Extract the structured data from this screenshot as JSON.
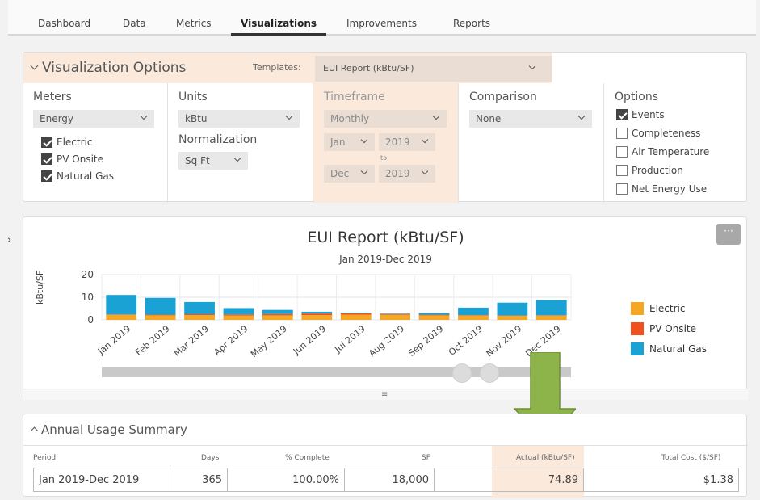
{
  "nav": {
    "tabs": [
      "Dashboard",
      "Data",
      "Metrics",
      "Visualizations",
      "Improvements",
      "Reports"
    ],
    "active": "Visualizations"
  },
  "options": {
    "title": "Visualization Options",
    "templates_label": "Templates:",
    "template_value": "EUI Report (kBtu/SF)",
    "meters": {
      "title": "Meters",
      "value": "Energy",
      "items": [
        {
          "label": "Electric",
          "checked": true
        },
        {
          "label": "PV Onsite",
          "checked": true
        },
        {
          "label": "Natural Gas",
          "checked": true
        }
      ]
    },
    "units": {
      "title": "Units",
      "value": "kBtu",
      "normalization_title": "Normalization",
      "normalization_value": "Sq Ft"
    },
    "timeframe": {
      "title": "Timeframe",
      "period": "Monthly",
      "start_month": "Jan",
      "start_year": "2019",
      "to": "to",
      "end_month": "Dec",
      "end_year": "2019"
    },
    "comparison": {
      "title": "Comparison",
      "value": "None"
    },
    "extras": {
      "title": "Options",
      "items": [
        {
          "label": "Events",
          "checked": true
        },
        {
          "label": "Completeness",
          "checked": false
        },
        {
          "label": "Air Temperature",
          "checked": false
        },
        {
          "label": "Production",
          "checked": false
        },
        {
          "label": "Net Energy Use",
          "checked": false
        }
      ]
    }
  },
  "chart_panel": {
    "more_label": "···",
    "grip": "≡"
  },
  "chart_data": {
    "type": "bar",
    "title": "EUI Report (kBtu/SF)",
    "subtitle": "Jan 2019-Dec 2019",
    "ylabel": "kBtu/SF",
    "xlabel": "",
    "ylim": [
      0,
      20
    ],
    "yticks": [
      0,
      10,
      20
    ],
    "stacked": true,
    "grid": true,
    "legend_position": "right",
    "categories": [
      "Jan 2019",
      "Feb 2019",
      "Mar 2019",
      "Apr 2019",
      "May 2019",
      "Jun 2019",
      "Jul 2019",
      "Aug 2019",
      "Sep 2019",
      "Oct 2019",
      "Nov 2019",
      "Dec 2019"
    ],
    "series": [
      {
        "name": "Electric",
        "color": "#f5a623",
        "values": [
          2.2,
          2.0,
          2.1,
          1.9,
          2.0,
          2.1,
          2.3,
          2.3,
          2.0,
          1.9,
          1.8,
          1.9
        ]
      },
      {
        "name": "PV Onsite",
        "color": "#f0501e",
        "values": [
          0.2,
          0.3,
          0.4,
          0.5,
          0.6,
          0.7,
          0.6,
          0.3,
          0.3,
          0.2,
          0.1,
          0.1
        ]
      },
      {
        "name": "Natural Gas",
        "color": "#1ba2d4",
        "values": [
          8.6,
          7.4,
          5.4,
          2.8,
          1.8,
          0.8,
          0.3,
          0.2,
          0.8,
          3.3,
          5.7,
          6.7
        ]
      }
    ]
  },
  "summary": {
    "title": "Annual Usage Summary",
    "columns": [
      "Period",
      "Days",
      "% Complete",
      "SF",
      "Actual (kBtu/SF)",
      "Total Cost ($/SF)"
    ],
    "row": [
      "Jan 2019-Dec 2019",
      "365",
      "100.00%",
      "18,000",
      "74.89",
      "$1.38"
    ]
  },
  "colors": {
    "highlight": "#fbe9dc",
    "arrow": "#8db44a"
  }
}
